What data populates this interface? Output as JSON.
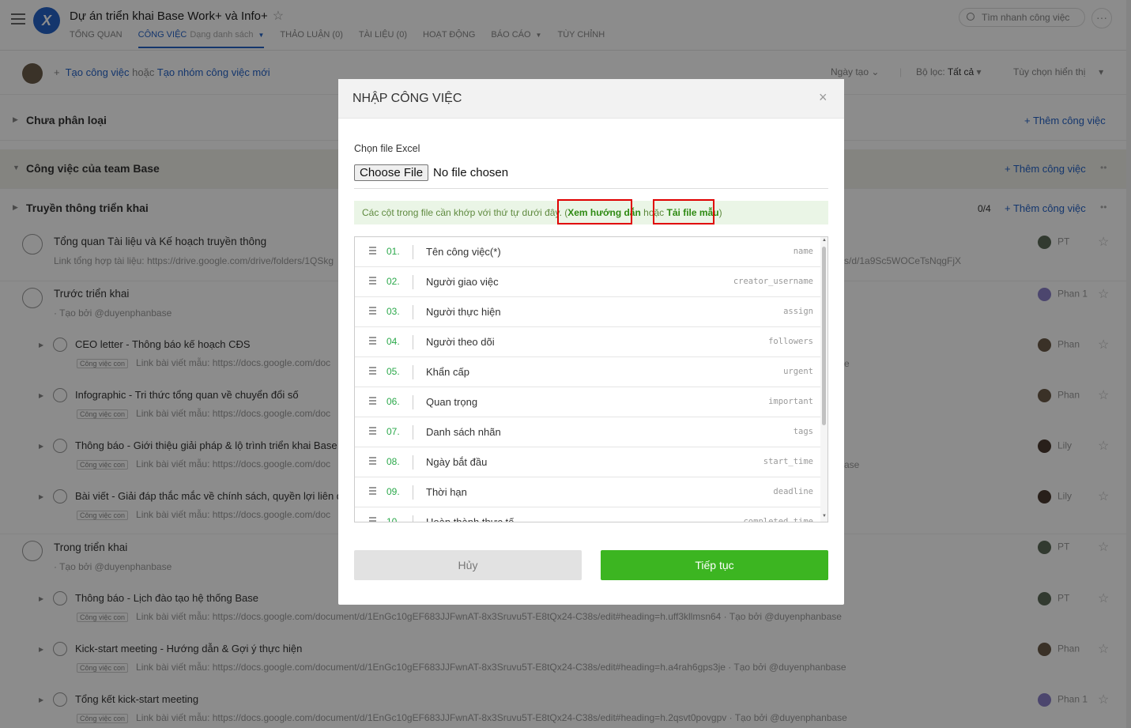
{
  "header": {
    "project_title": "Dự án triển khai Base Work+ và Info+",
    "tabs": [
      {
        "label": "Tổng quan"
      },
      {
        "label": "Công việc",
        "sub": "Dạng danh sách"
      },
      {
        "label": "Thảo luận (0)"
      },
      {
        "label": "Tài liệu (0)"
      },
      {
        "label": "Hoạt động"
      },
      {
        "label": "Báo cáo"
      },
      {
        "label": "Tùy chỉnh"
      }
    ],
    "search_placeholder": "Tìm nhanh công việc"
  },
  "toolbar": {
    "create_task": "Tạo công việc",
    "or": "hoặc",
    "create_group": "Tạo nhóm công việc mới",
    "sort": "Ngày tạo",
    "filter_label": "Bộ lọc:",
    "filter_value": "Tất cả",
    "display_options": "Tùy chọn hiển thị"
  },
  "sections": [
    {
      "title": "Chưa phân loại",
      "add": "Thêm công việc"
    },
    {
      "title": "Công việc của team Base",
      "add": "Thêm công việc"
    },
    {
      "title": "Truyền thông triển khai",
      "add": "Thêm công việc",
      "count": "0/4"
    }
  ],
  "tasks": [
    {
      "title": "Tổng quan Tài liệu và Kế hoạch truyền thông",
      "sub": "Link tổng hợp tài liệu: https://drive.google.com/drive/folders/1QSkg",
      "sub_right": "s/d/1a9Sc5WOCeTsNqgFjX",
      "assignee": "PT"
    },
    {
      "title": "Trước triển khai",
      "sub": "· Tạo bởi @duyenphanbase",
      "assignee": "Phan 1"
    },
    {
      "title": "CEO letter - Thông báo kế hoạch CĐS",
      "chip": "Công việc con",
      "sub": "Link bài viết mẫu: https://docs.google.com/doc",
      "sub_right": "e",
      "assignee": "Phan"
    },
    {
      "title": "Infographic - Tri thức tổng quan về chuyển đổi số",
      "chip": "Công việc con",
      "sub": "Link bài viết mẫu: https://docs.google.com/doc",
      "assignee": "Phan"
    },
    {
      "title": "Thông báo - Giới thiệu giải pháp & lộ trình triển khai Base",
      "chip": "Công việc con",
      "sub": "Link bài viết mẫu: https://docs.google.com/doc",
      "sub_right": "ase",
      "assignee": "Lily"
    },
    {
      "title": "Bài viết - Giải đáp thắc mắc về chính sách, quyền lợi liên qu",
      "chip": "Công việc con",
      "sub": "Link bài viết mẫu: https://docs.google.com/doc",
      "assignee": "Lily"
    },
    {
      "title": "Trong triển khai",
      "sub": "· Tạo bởi @duyenphanbase",
      "assignee": "PT"
    },
    {
      "title": "Thông báo - Lịch đào tạo hệ thống Base",
      "chip": "Công việc con",
      "sub": "Link bài viết mẫu: https://docs.google.com/document/d/1EnGc10gEF683JJFwnAT-8x3Sruvu5T-E8tQx24-C38s/edit#heading=h.uff3kllmsn64 · Tạo bởi @duyenphanbase",
      "assignee": "PT"
    },
    {
      "title": "Kick-start meeting - Hướng dẫn & Gợi ý thực hiện",
      "chip": "Công việc con",
      "sub": "Link bài viết mẫu: https://docs.google.com/document/d/1EnGc10gEF683JJFwnAT-8x3Sruvu5T-E8tQx24-C38s/edit#heading=h.a4rah6gps3je · Tạo bởi @duyenphanbase",
      "assignee": "Phan"
    },
    {
      "title": "Tổng kết kick-start meeting",
      "chip": "Công việc con",
      "sub": "Link bài viết mẫu: https://docs.google.com/document/d/1EnGc10gEF683JJFwnAT-8x3Sruvu5T-E8tQx24-C38s/edit#heading=h.2qsvt0povgpv · Tạo bởi @duyenphanbase",
      "assignee": "Phan 1"
    }
  ],
  "modal": {
    "title": "NHẬP CÔNG VIỆC",
    "file_label": "Chọn file Excel",
    "choose_file": "Choose File",
    "no_file": "No file chosen",
    "note_prefix": "Các cột trong file cần khớp với thứ tự dưới đây. (",
    "guide_link": "Xem hướng dẫn",
    "or": "hoặc",
    "template_link": "Tải file mẫu",
    "note_suffix": ")",
    "columns": [
      {
        "num": "01.",
        "name": "Tên công việc(*)",
        "key": "name"
      },
      {
        "num": "02.",
        "name": "Người giao việc",
        "key": "creator_username"
      },
      {
        "num": "03.",
        "name": "Người thực hiện",
        "key": "assign"
      },
      {
        "num": "04.",
        "name": "Người theo dõi",
        "key": "followers"
      },
      {
        "num": "05.",
        "name": "Khẩn cấp",
        "key": "urgent"
      },
      {
        "num": "06.",
        "name": "Quan trọng",
        "key": "important"
      },
      {
        "num": "07.",
        "name": "Danh sách nhãn",
        "key": "tags"
      },
      {
        "num": "08.",
        "name": "Ngày bắt đầu",
        "key": "start_time"
      },
      {
        "num": "09.",
        "name": "Thời hạn",
        "key": "deadline"
      },
      {
        "num": "10.",
        "name": "Hoàn thành thực tế",
        "key": "completed_time"
      }
    ],
    "cancel": "Hủy",
    "continue": "Tiếp tục"
  }
}
